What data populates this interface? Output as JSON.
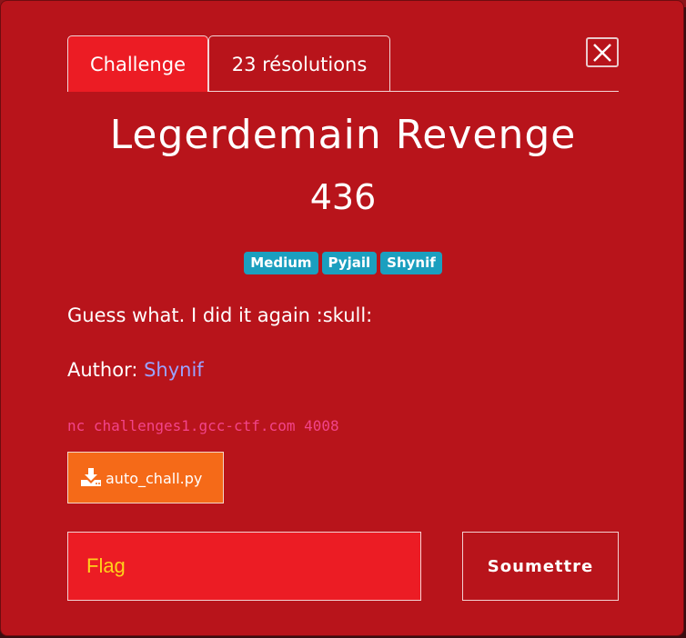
{
  "tabs": [
    {
      "label": "Challenge",
      "active": true
    },
    {
      "label": "23 résolutions",
      "active": false
    }
  ],
  "challenge": {
    "name": "Legerdemain Revenge",
    "points": "436",
    "tags": [
      "Medium",
      "Pyjail",
      "Shynif"
    ],
    "description": "Guess what. I did it again :skull:",
    "author_label": "Author: ",
    "author_name": "Shynif",
    "connection": "nc challenges1.gcc-ctf.com 4008",
    "file_name": "auto_chall.py"
  },
  "form": {
    "flag_placeholder": "Flag",
    "submit_label": "Soumettre"
  },
  "icons": {
    "close": "close-icon",
    "download": "download-icon"
  },
  "colors": {
    "modal_background": "#b8141b",
    "active_tab": "#ec1c24",
    "tag": "#1b9fbf",
    "file_button": "#f56a18",
    "flag_placeholder": "#ffd11a",
    "author_link": "#9aa3ff",
    "command_text": "#f2448a"
  }
}
